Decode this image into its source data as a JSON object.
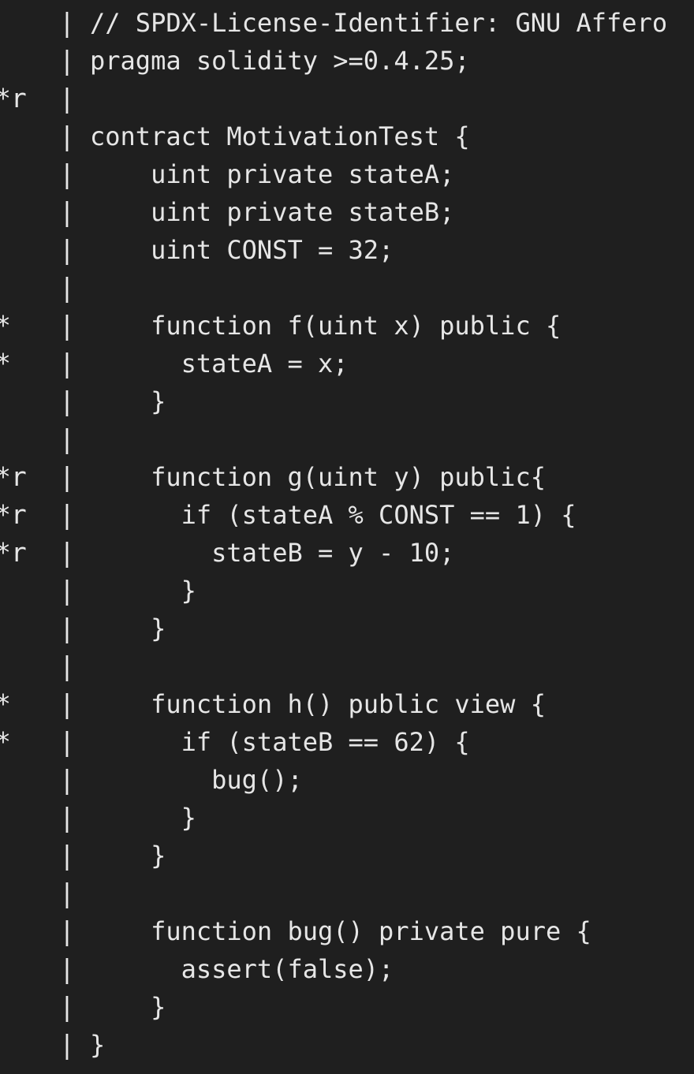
{
  "code": {
    "lines": [
      {
        "marker": "",
        "separator": "|",
        "text": "// SPDX-License-Identifier: GNU Affero"
      },
      {
        "marker": "",
        "separator": "|",
        "text": "pragma solidity >=0.4.25;"
      },
      {
        "marker": "*r",
        "separator": "|",
        "text": ""
      },
      {
        "marker": "",
        "separator": "|",
        "text": "contract MotivationTest {"
      },
      {
        "marker": "",
        "separator": "|",
        "text": "    uint private stateA;"
      },
      {
        "marker": "",
        "separator": "|",
        "text": "    uint private stateB;"
      },
      {
        "marker": "",
        "separator": "|",
        "text": "    uint CONST = 32;"
      },
      {
        "marker": "",
        "separator": "|",
        "text": ""
      },
      {
        "marker": "*",
        "separator": "|",
        "text": "    function f(uint x) public {"
      },
      {
        "marker": "*",
        "separator": "|",
        "text": "      stateA = x;"
      },
      {
        "marker": "",
        "separator": "|",
        "text": "    }"
      },
      {
        "marker": "",
        "separator": "|",
        "text": ""
      },
      {
        "marker": "*r",
        "separator": "|",
        "text": "    function g(uint y) public{"
      },
      {
        "marker": "*r",
        "separator": "|",
        "text": "      if (stateA % CONST == 1) {"
      },
      {
        "marker": "*r",
        "separator": "|",
        "text": "        stateB = y - 10;"
      },
      {
        "marker": "",
        "separator": "|",
        "text": "      }"
      },
      {
        "marker": "",
        "separator": "|",
        "text": "    }"
      },
      {
        "marker": "",
        "separator": "|",
        "text": ""
      },
      {
        "marker": "*",
        "separator": "|",
        "text": "    function h() public view {"
      },
      {
        "marker": "*",
        "separator": "|",
        "text": "      if (stateB == 62) {"
      },
      {
        "marker": "",
        "separator": "|",
        "text": "        bug();"
      },
      {
        "marker": "",
        "separator": "|",
        "text": "      }"
      },
      {
        "marker": "",
        "separator": "|",
        "text": "    }"
      },
      {
        "marker": "",
        "separator": "|",
        "text": ""
      },
      {
        "marker": "",
        "separator": "|",
        "text": "    function bug() private pure {"
      },
      {
        "marker": "",
        "separator": "|",
        "text": "      assert(false);"
      },
      {
        "marker": "",
        "separator": "|",
        "text": "    }"
      },
      {
        "marker": "",
        "separator": "|",
        "text": "}"
      }
    ]
  }
}
